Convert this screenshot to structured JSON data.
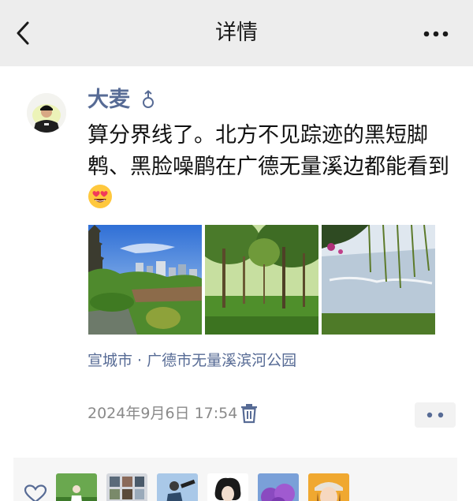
{
  "nav": {
    "title": "详情",
    "back_icon": "chevron-left-icon",
    "more_icon": "more-horizontal-icon"
  },
  "post": {
    "author": "大麦",
    "gender_icon": "male-icon",
    "text": "算分界线了。北方不见踪迹的黑短脚鹎、黑脸噪鹛在广德无量溪边都能看到",
    "emoji": "heart-eyes-emoji",
    "photos": [
      "photo-1",
      "photo-2",
      "photo-3"
    ],
    "location": "宣城市 · 广德市无量溪滨河公园",
    "timestamp": "2024年9月6日 17:54",
    "delete_icon": "trash-icon",
    "more_icon": "more-dots-icon"
  },
  "likes": {
    "icon": "heart-outline-icon",
    "avatars": [
      "like-avatar-1",
      "like-avatar-2",
      "like-avatar-3",
      "like-avatar-4",
      "like-avatar-5",
      "like-avatar-6"
    ]
  },
  "colors": {
    "link": "#576b95",
    "nav_bg": "#ededed",
    "text": "#111111",
    "meta": "#8a8a8a"
  }
}
